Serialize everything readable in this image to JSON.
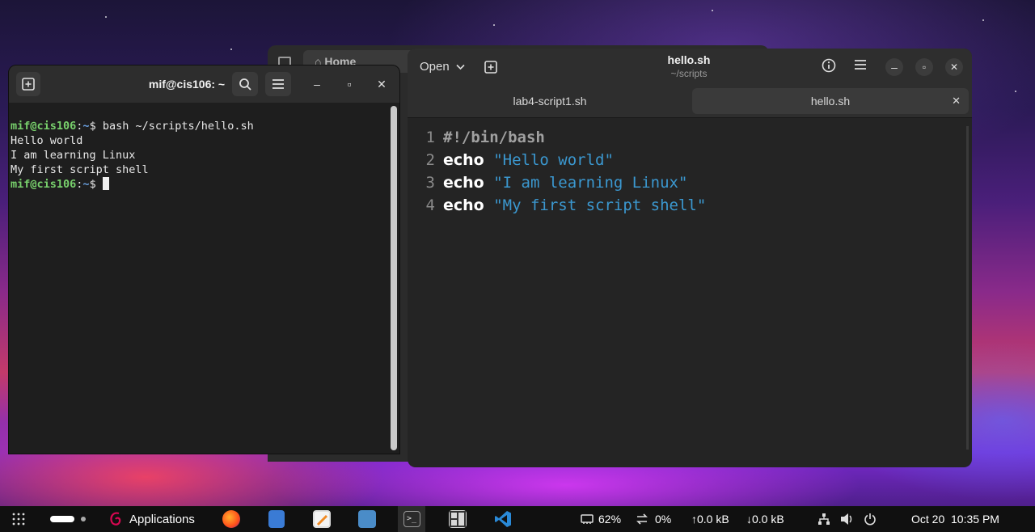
{
  "files_window": {
    "path_label": "Home"
  },
  "terminal": {
    "title": "mif@cis106: ~",
    "lines": [
      {
        "user": "mif@cis106",
        "path": "~",
        "cmd": "bash ~/scripts/hello.sh"
      },
      {
        "out": "Hello world"
      },
      {
        "out": "I am learning Linux"
      },
      {
        "out": "My first script shell"
      },
      {
        "user": "mif@cis106",
        "path": "~",
        "cmd": ""
      }
    ]
  },
  "editor": {
    "open_label": "Open",
    "title": "hello.sh",
    "subtitle": "~/scripts",
    "tabs": [
      {
        "label": "lab4-script1.sh",
        "active": false
      },
      {
        "label": "hello.sh",
        "active": true
      }
    ],
    "code": [
      {
        "n": "1",
        "comment": "#!/bin/bash"
      },
      {
        "n": "2",
        "kw": "echo",
        "str": "\"Hello world\""
      },
      {
        "n": "3",
        "kw": "echo",
        "str": "\"I am learning Linux\""
      },
      {
        "n": "4",
        "kw": "echo",
        "str": "\"My first script shell\""
      }
    ]
  },
  "taskbar": {
    "applications_label": "Applications",
    "battery": "62%",
    "cpu": "0%",
    "upload": "0.0 kB",
    "download": "0.0 kB",
    "clock": "Oct 20  10:35 PM"
  },
  "colors": {
    "prompt_user": "#78d06c",
    "prompt_path": "#6aa0e0",
    "string": "#3b98d0",
    "accent_vscode": "#2a8ad8"
  }
}
